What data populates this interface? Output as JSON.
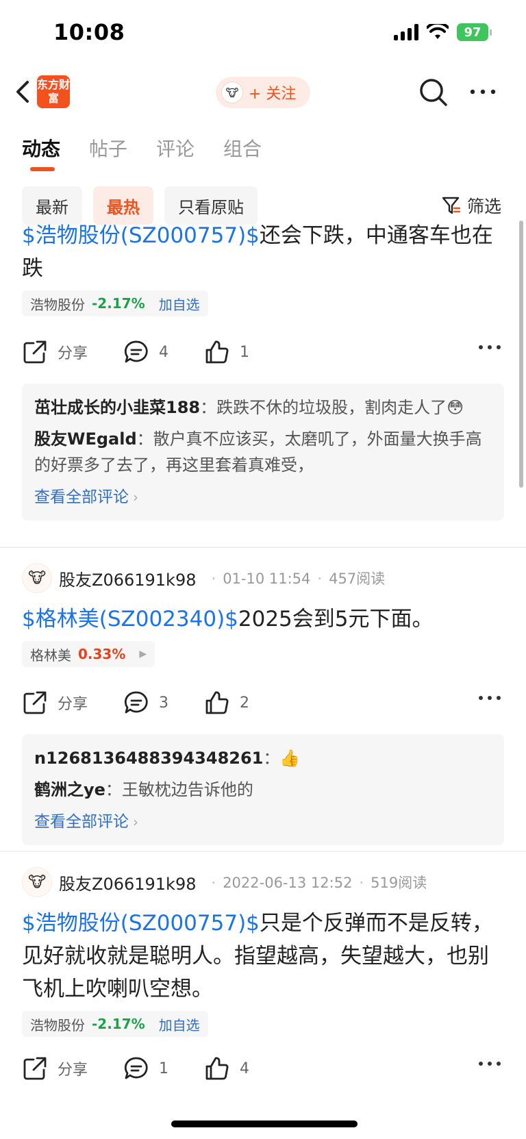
{
  "status": {
    "time": "10:08",
    "battery": "97"
  },
  "nav": {
    "logo_text": "东方财富",
    "follow_label": "+ 关注"
  },
  "tabs": [
    "动态",
    "帖子",
    "评论",
    "组合"
  ],
  "filters": [
    "最新",
    "最热",
    "只看原贴"
  ],
  "filter_button": "筛选",
  "posts": [
    {
      "ticker": "$浩物股份(SZ000757)$",
      "text": "还会下跌，中通客车也在跌",
      "tag": {
        "name": "浩物股份",
        "pct": "-2.17%",
        "action": "加自选"
      },
      "share_label": "分享",
      "comments_count": "4",
      "likes_count": "1",
      "comments": [
        {
          "user": "茁壮成长的小韭菜188",
          "text": "跌跌不休的垃圾股，割肉走人了😳"
        },
        {
          "user": "股友WEgald",
          "text": "散户真不应该买，太磨叽了，外面量大换手高的好票多了去了，再这里套着真难受，"
        }
      ],
      "see_all": "查看全部评论"
    },
    {
      "author": "股友Z066191k98",
      "date": "01-10 11:54",
      "reads": "457阅读",
      "ticker": "$格林美(SZ002340)$",
      "text": "2025会到5元下面。",
      "tag": {
        "name": "格林美",
        "pct": "0.33%"
      },
      "share_label": "分享",
      "comments_count": "3",
      "likes_count": "2",
      "comments": [
        {
          "user": "n1268136488394348261",
          "text": "👍"
        },
        {
          "user": "鹤洲之ye",
          "text": "王敏枕边告诉他的"
        }
      ],
      "see_all": "查看全部评论"
    },
    {
      "author": "股友Z066191k98",
      "date": "2022-06-13 12:52",
      "reads": "519阅读",
      "ticker": "$浩物股份(SZ000757)$",
      "text": "只是个反弹而不是反转，见好就收就是聪明人。指望越高，失望越大，也别飞机上吹喇叭空想。",
      "tag": {
        "name": "浩物股份",
        "pct": "-2.17%",
        "action": "加自选"
      },
      "share_label": "分享",
      "comments_count": "1",
      "likes_count": "4"
    }
  ],
  "colors": {
    "accent": "#f0521c",
    "link": "#1a73e8",
    "down": "#1aa34a",
    "up": "#e8421c"
  }
}
